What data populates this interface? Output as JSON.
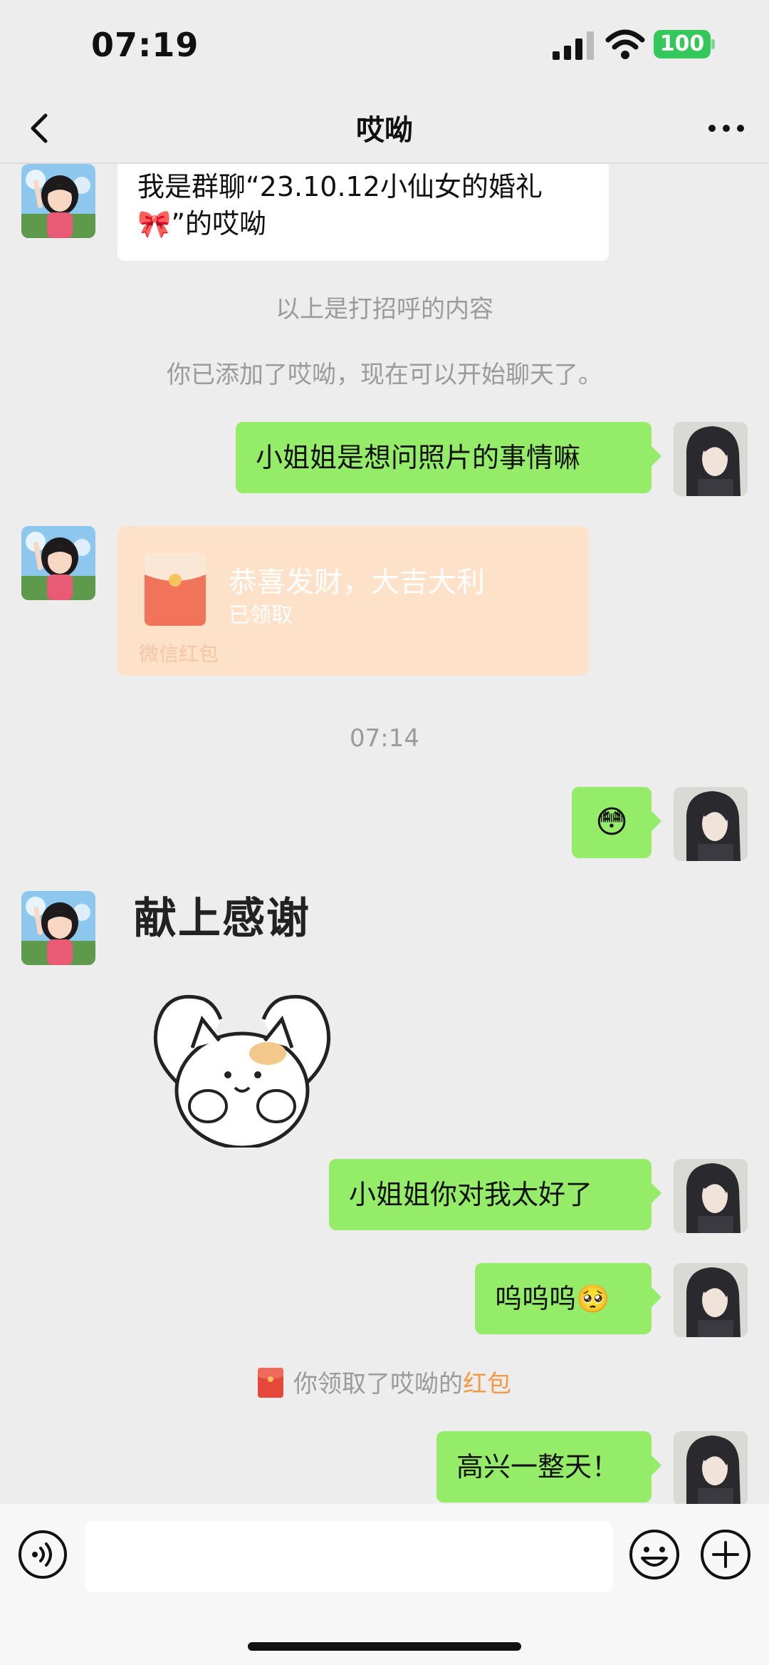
{
  "status_bar": {
    "time": "07:19",
    "battery": "100"
  },
  "nav": {
    "title": "哎呦"
  },
  "messages": {
    "greeting_text": "我是群聊“23.10.12小仙女的婚礼🎀”的哎呦",
    "sys_greeting_note": "以上是打招呼的内容",
    "sys_added": "你已添加了哎呦，现在可以开始聊天了。",
    "out_1": "小姐姐是想问照片的事情嘛",
    "red_packet": {
      "title": "恭喜发财，大吉大利",
      "status": "已领取",
      "footer": "微信红包"
    },
    "timestamp": "07:14",
    "out_2": "😳",
    "sticker_text": "献上感谢",
    "out_3": "小姐姐你对我太好了",
    "out_4": "呜呜呜🥺",
    "sys_received_prefix": "你领取了哎呦的",
    "sys_received_link": "红包",
    "out_5": "高兴一整天！"
  },
  "input_bar": {
    "placeholder": ""
  },
  "colors": {
    "background": "#ededed",
    "outgoing_bubble": "#95ec69",
    "incoming_bubble": "#ffffff",
    "red_packet_bg": "#fde2c9",
    "link_orange": "#f29a48",
    "battery_green": "#34c759"
  },
  "icons": [
    "back-arrow-icon",
    "more-dots-icon",
    "signal-icon",
    "wifi-icon",
    "voice-icon",
    "emoji-icon",
    "plus-icon",
    "red-packet-icon"
  ]
}
